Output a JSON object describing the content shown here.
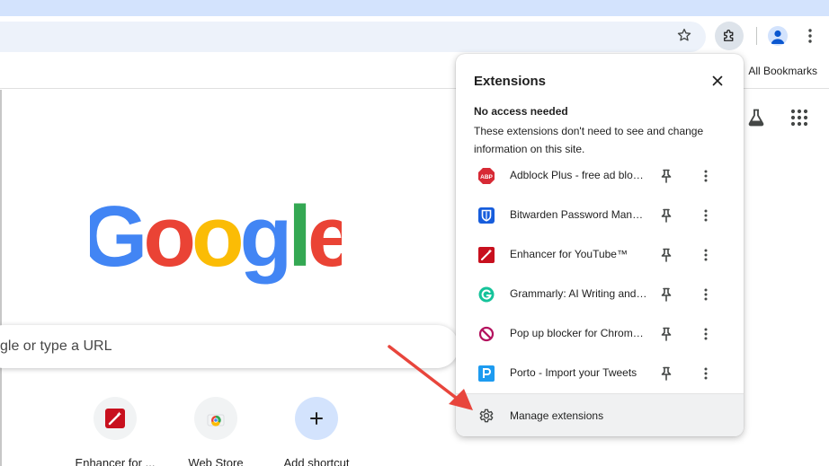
{
  "toolbar": {
    "bookmark_star_icon": "star-outline",
    "extensions_icon": "puzzle-piece",
    "profile_icon": "person",
    "menu_icon": "three-dots-vertical"
  },
  "bookmarks_bar": {
    "all_bookmarks_label": "All Bookmarks"
  },
  "ntp": {
    "logo_text": "Google",
    "search_placeholder": "gle or type a URL",
    "shortcuts": [
      {
        "label": "Enhancer for ...",
        "icon": "enhancer-icon"
      },
      {
        "label": "Web Store",
        "icon": "web-store-icon"
      },
      {
        "label": "Add shortcut",
        "icon": "plus-icon"
      }
    ]
  },
  "extensions_panel": {
    "title": "Extensions",
    "section_heading": "No access needed",
    "section_description": "These extensions don't need to see and change information on this site.",
    "extensions": [
      {
        "name": "Adblock Plus - free ad blocker",
        "icon": "abp-icon",
        "color": "#d72a35"
      },
      {
        "name": "Bitwarden Password Manager",
        "icon": "bitwarden-icon",
        "color": "#175ddc"
      },
      {
        "name": "Enhancer for YouTube™",
        "icon": "enhancer-icon",
        "color": "#c8101e"
      },
      {
        "name": "Grammarly: AI Writing and Grammar Checker",
        "icon": "grammarly-icon",
        "color": "#15c39a"
      },
      {
        "name": "Pop up blocker for Chrome™",
        "icon": "popup-blocker-icon",
        "color": "#b4125e"
      },
      {
        "name": "Porto - Import your Tweets",
        "icon": "porto-icon",
        "color": "#1d9bf0"
      }
    ],
    "manage_label": "Manage extensions"
  },
  "colors": {
    "google_blue": "#4285f4",
    "google_red": "#ea4335",
    "google_yellow": "#fbbc05",
    "google_green": "#34a853",
    "annotation_arrow": "#e8453c"
  }
}
